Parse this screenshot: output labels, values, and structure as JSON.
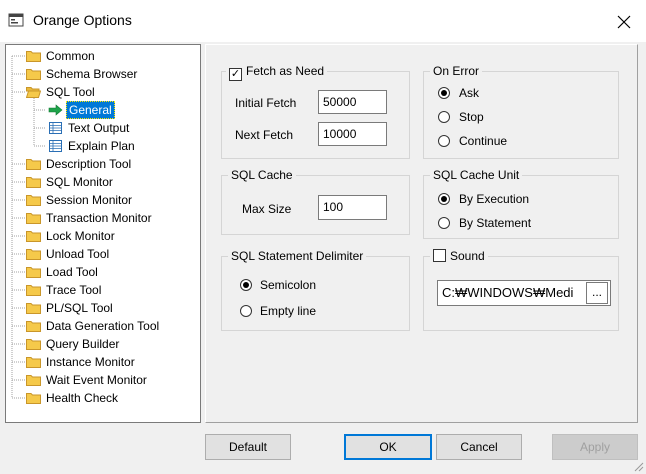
{
  "window": {
    "title": "Orange Options",
    "close_icon": "close-icon"
  },
  "tree": {
    "items": [
      {
        "label": "Common",
        "icon": "folder-icon",
        "level": 0
      },
      {
        "label": "Schema Browser",
        "icon": "folder-icon",
        "level": 0
      },
      {
        "label": "SQL Tool",
        "icon": "open-folder-icon",
        "level": 0
      },
      {
        "label": "General",
        "icon": "arrow-right-icon",
        "level": 1,
        "selected": true
      },
      {
        "label": "Text Output",
        "icon": "grid-icon",
        "level": 1
      },
      {
        "label": "Explain Plan",
        "icon": "grid-icon",
        "level": 1
      },
      {
        "label": "Description Tool",
        "icon": "folder-icon",
        "level": 0
      },
      {
        "label": "SQL Monitor",
        "icon": "folder-icon",
        "level": 0
      },
      {
        "label": "Session Monitor",
        "icon": "folder-icon",
        "level": 0
      },
      {
        "label": "Transaction Monitor",
        "icon": "folder-icon",
        "level": 0
      },
      {
        "label": "Lock Monitor",
        "icon": "folder-icon",
        "level": 0
      },
      {
        "label": "Unload Tool",
        "icon": "folder-icon",
        "level": 0
      },
      {
        "label": "Load Tool",
        "icon": "folder-icon",
        "level": 0
      },
      {
        "label": "Trace Tool",
        "icon": "folder-icon",
        "level": 0
      },
      {
        "label": "PL/SQL Tool",
        "icon": "folder-icon",
        "level": 0
      },
      {
        "label": "Data Generation Tool",
        "icon": "folder-icon",
        "level": 0
      },
      {
        "label": "Query Builder",
        "icon": "folder-icon",
        "level": 0
      },
      {
        "label": "Instance Monitor",
        "icon": "folder-icon",
        "level": 0
      },
      {
        "label": "Wait Event Monitor",
        "icon": "folder-icon",
        "level": 0
      },
      {
        "label": "Health Check",
        "icon": "folder-icon",
        "level": 0
      }
    ]
  },
  "fetch": {
    "checkbox_label": "Fetch as Need",
    "checked": true,
    "initial_label": "Initial Fetch",
    "initial_value": "50000",
    "next_label": "Next Fetch",
    "next_value": "10000"
  },
  "on_error": {
    "title": "On Error",
    "options": [
      "Ask",
      "Stop",
      "Continue"
    ],
    "selected": "Ask"
  },
  "sql_cache": {
    "title": "SQL Cache",
    "max_label": "Max Size",
    "max_value": "100"
  },
  "cache_unit": {
    "title": "SQL Cache Unit",
    "options": [
      "By Execution",
      "By Statement"
    ],
    "selected": "By Execution"
  },
  "delimiter": {
    "title": "SQL Statement Delimiter",
    "options": [
      "Semicolon",
      "Empty line"
    ],
    "selected": "Semicolon"
  },
  "sound": {
    "checkbox_label": "Sound",
    "checked": false,
    "path_value": "C:₩WINDOWS₩Medi",
    "browse_label": "..."
  },
  "buttons": {
    "default_label": "Default",
    "ok_label": "OK",
    "cancel_label": "Cancel",
    "apply_label": "Apply",
    "apply_enabled": false
  },
  "colors": {
    "selection": "#0078d7",
    "folder": "#f5c94a",
    "arrow": "#1fa34a"
  }
}
